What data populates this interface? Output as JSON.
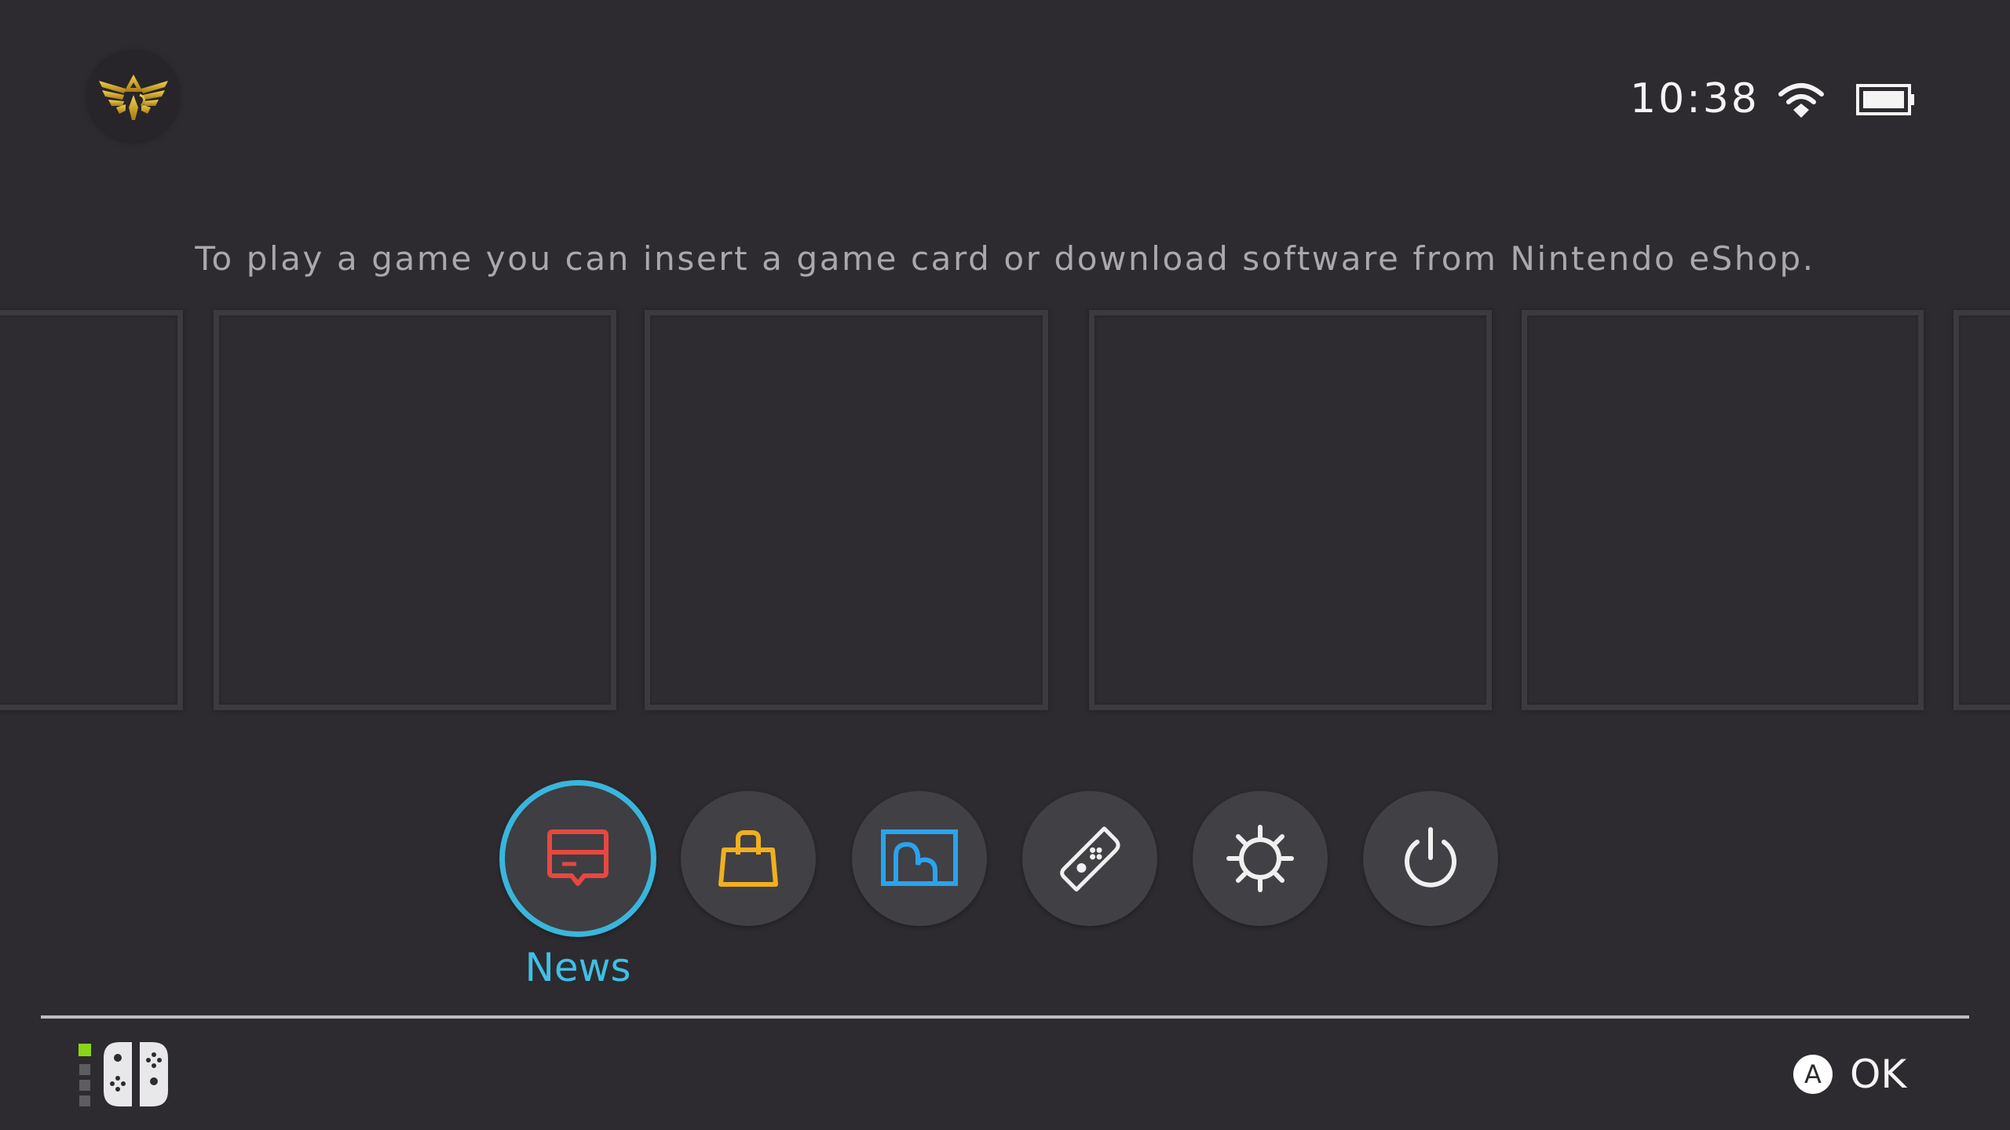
{
  "header": {
    "user_avatar": "hylian-crest-icon",
    "time": "10:38",
    "wifi_icon": "wifi-icon",
    "battery_icon": "battery-icon",
    "battery_level_percent": 100
  },
  "main": {
    "hint_text": "To play a game you can insert a game card or download software from Nintendo eShop.",
    "game_slots": [
      {
        "state": "empty"
      },
      {
        "state": "empty"
      },
      {
        "state": "empty"
      },
      {
        "state": "empty"
      },
      {
        "state": "empty"
      },
      {
        "state": "empty"
      }
    ]
  },
  "menu": {
    "selected_index": 0,
    "items": [
      {
        "label": "News",
        "icon": "news-icon",
        "color": "#e8473f"
      },
      {
        "label": "Nintendo eShop",
        "icon": "shopping-bag-icon",
        "color": "#f0b020"
      },
      {
        "label": "Album",
        "icon": "album-icon",
        "color": "#2aa3ee"
      },
      {
        "label": "Controllers",
        "icon": "joycon-icon",
        "color": "#f0f0f0"
      },
      {
        "label": "System Settings",
        "icon": "gear-icon",
        "color": "#f0f0f0"
      },
      {
        "label": "Sleep Mode",
        "icon": "power-icon",
        "color": "#f0f0f0"
      }
    ],
    "selected_label": "News",
    "accent_color": "#39b6dc"
  },
  "footer": {
    "controller_player": 1,
    "controller_icon": "joycons-icon",
    "a_button": "A",
    "ok_label": "OK"
  }
}
